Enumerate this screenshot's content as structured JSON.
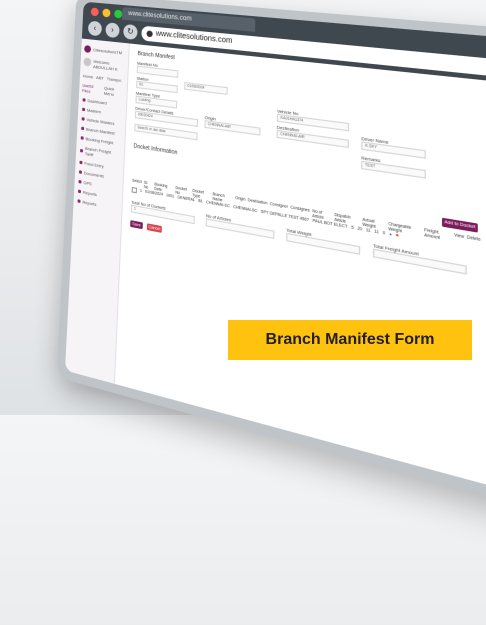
{
  "browser": {
    "tab_title": "www.clitesolutions.com",
    "url": "www.clitesolutions.com"
  },
  "sidebar": {
    "brand": "ClitesolutionsTM",
    "user_name": "Welcome",
    "user_sub": "ABDULLAH K",
    "quick_links": [
      "Home",
      "ABT",
      "Transpo"
    ],
    "tabs": [
      "Useful Files",
      "Quick Menu"
    ],
    "items": [
      "Dashboard",
      "Masters",
      "Vehicle Masters",
      "Branch Manifest",
      "Booking Freight",
      "Branch Freight Tariff",
      "Fund Entry",
      "Documents",
      "GPS",
      "Reports",
      "Reports"
    ]
  },
  "page": {
    "title": "Branch Manifest",
    "fields": {
      "manifest_no_label": "Manifest No",
      "manifest_no_value": "",
      "date_label": "Date",
      "date_value": "01/08/2024",
      "manifest_type_label": "Manifest Type",
      "manifest_type_value": "Loading",
      "station_label": "Station",
      "branch_value": "B1",
      "from_label": "Driver/Contact Details",
      "from_value": "09030424",
      "origin_label": "Origin",
      "origin_value": "CHENNAI-AIR",
      "vehicle_label": "Vehicle No",
      "vehicle_value": "KA01HA1374",
      "destination_label": "Destination",
      "destination_value": "CHENNAI-AIR",
      "driver_label": "Driver Name",
      "driver_value": "K.SKY",
      "remarks_label": "Remarks",
      "remarks_value": "TEST",
      "contact_placeholder": "Search or use data"
    },
    "section_title": "Docket Information",
    "table_headers": [
      "Select",
      "Sl. No",
      "Booking Date",
      "Docket No",
      "Docket Type",
      "Branch Name",
      "Origin",
      "Destination",
      "Consignor",
      "Consignee",
      "No of Article",
      "Dispatch Article",
      "Actual Weight",
      "Chargeable Weight",
      "Freight Amount",
      "View",
      "Delete"
    ],
    "table_row": [
      "",
      "1",
      "01/08/2024",
      "1001",
      "GENERAL",
      "B1",
      "CHENNAI-SC",
      "CHENNAI-SC",
      "SPT DEPALLE TEST 4567",
      "PAUL BOT ELECT",
      "5",
      "20",
      "11",
      "11",
      "0"
    ],
    "add_docket_btn": "Add to Docket",
    "summary": {
      "total_dockets_label": "Total No of Dockets",
      "total_dockets_value": "1",
      "no_articles_label": "No of Articles",
      "total_weight_label": "Total Weight",
      "total_freight_label": "Total Freight Amount"
    },
    "save_btn": "Save",
    "cancel_btn": "Cancel"
  },
  "banner": {
    "text": "Branch Manifest Form"
  }
}
